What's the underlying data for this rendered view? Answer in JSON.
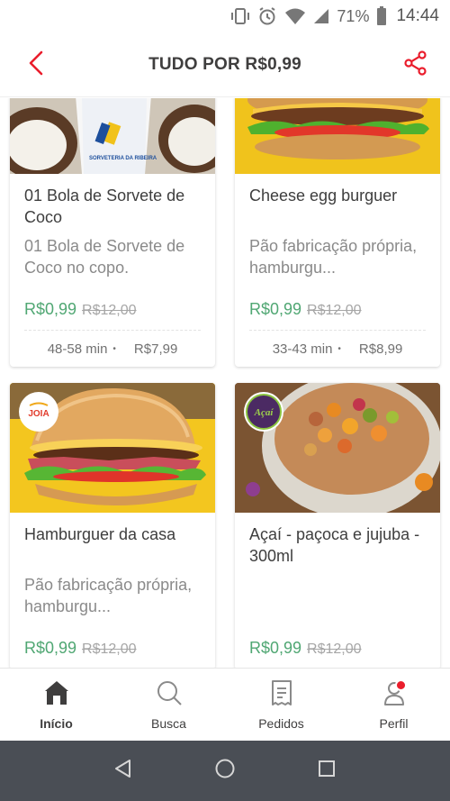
{
  "status_bar": {
    "battery_percent": "71%",
    "time": "14:44",
    "icons": [
      "vibrate-icon",
      "alarm-icon",
      "wifi-icon",
      "signal-icon",
      "battery-icon"
    ]
  },
  "header": {
    "title": "TUDO POR R$0,99",
    "back_icon": "chevron-left-icon",
    "share_icon": "share-icon",
    "accent_color": "#ea1d2c"
  },
  "products": [
    {
      "name": "01 Bola de Sorvete de Coco",
      "description": "01 Bola de Sorvete de Coco no copo.",
      "price": "R$0,99",
      "old_price": "R$12,00",
      "delivery_time": "48-58 min",
      "delivery_fee": "R$7,99",
      "photo_text": "SORVETERIA DA RIBEIRA"
    },
    {
      "name": "Cheese egg burguer",
      "description": "Pão fabricação própria, hamburgu...",
      "price": "R$0,99",
      "old_price": "R$12,00",
      "delivery_time": "33-43 min",
      "delivery_fee": "R$8,99"
    },
    {
      "name": "Hamburguer da casa",
      "description": "Pão fabricação própria, hamburgu...",
      "price": "R$0,99",
      "old_price": "R$12,00",
      "store_logo_text": "JOIA"
    },
    {
      "name": "Açaí - paçoca e jujuba - 300ml",
      "description": "",
      "price": "R$0,99",
      "old_price": "R$12,00",
      "store_logo_text": "Açaí"
    }
  ],
  "bottom_nav": {
    "items": [
      {
        "label": "Início",
        "icon": "home-icon",
        "active": true
      },
      {
        "label": "Busca",
        "icon": "search-icon",
        "active": false
      },
      {
        "label": "Pedidos",
        "icon": "receipt-icon",
        "active": false
      },
      {
        "label": "Perfil",
        "icon": "profile-icon",
        "active": false,
        "has_notification": true
      }
    ]
  },
  "android_nav": {
    "icons": [
      "back-triangle-icon",
      "home-circle-icon",
      "recents-square-icon"
    ]
  },
  "colors": {
    "price_green": "#50a773",
    "brand_red": "#ea1d2c",
    "text_dark": "#3e3e3e",
    "text_muted": "#8a8a8a"
  }
}
